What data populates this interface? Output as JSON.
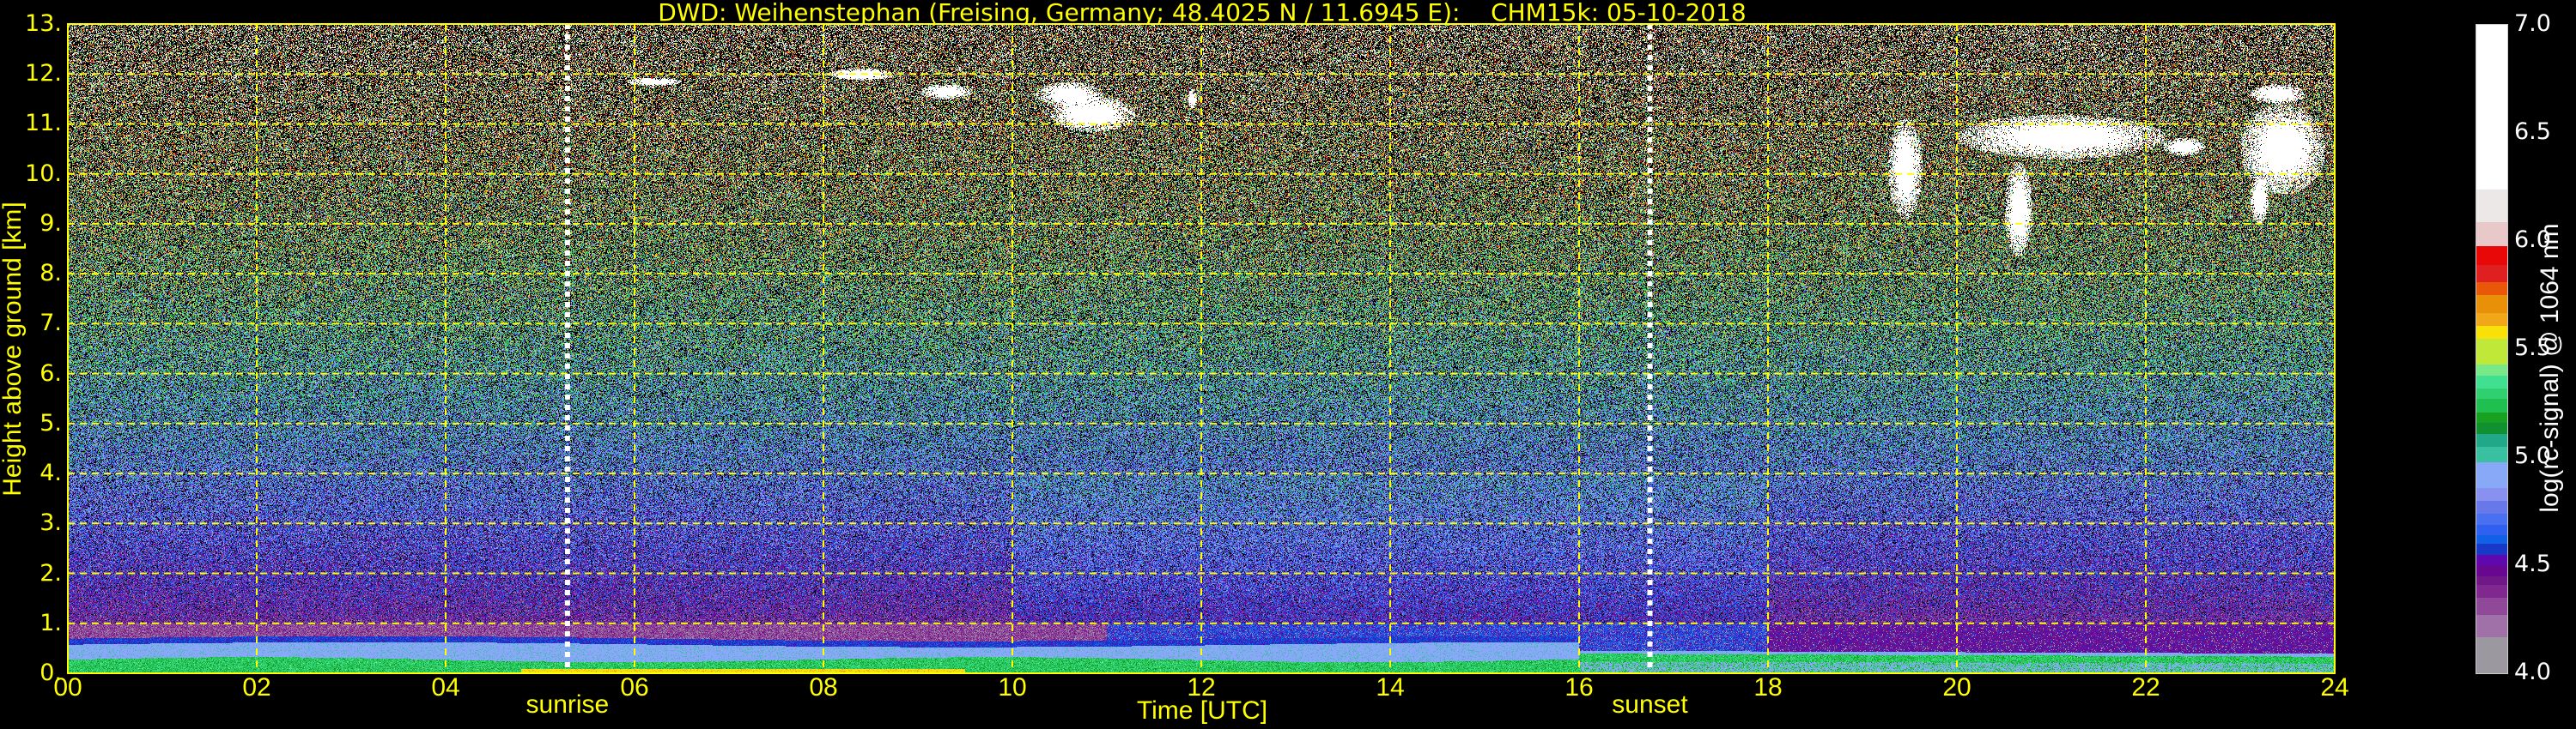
{
  "chart_data": {
    "type": "heatmap",
    "title": "DWD: Weihenstephan (Freising, Germany; 48.4025 N / 11.6945 E):    CHM15k: 05-10-2018",
    "xlabel": "Time [UTC]",
    "ylabel": "Height above ground [km]",
    "xlim": [
      0,
      24
    ],
    "ylim": [
      0,
      13
    ],
    "xticks": [
      "00",
      "02",
      "04",
      "06",
      "08",
      "10",
      "12",
      "14",
      "16",
      "18",
      "20",
      "22",
      "24"
    ],
    "xtick_values": [
      0,
      2,
      4,
      6,
      8,
      10,
      12,
      14,
      16,
      18,
      20,
      22,
      24
    ],
    "yticks": [
      "0.",
      "1.",
      "2.",
      "3.",
      "4.",
      "5.",
      "6.",
      "7.",
      "8.",
      "9.",
      "10.",
      "11.",
      "12.",
      "13."
    ],
    "ytick_values": [
      0,
      1,
      2,
      3,
      4,
      5,
      6,
      7,
      8,
      9,
      10,
      11,
      12,
      13
    ],
    "grid": true,
    "grid_color": "#ffff00",
    "sunrise": {
      "label": "sunrise",
      "time_h": 5.29
    },
    "sunset": {
      "label": "sunset",
      "time_h": 16.75
    },
    "colorbar": {
      "label": "log(rc-signal) @ 1064 nm",
      "range": [
        4.0,
        7.0
      ],
      "ticks": [
        "4.0",
        "4.5",
        "5.0",
        "5.5",
        "6.0",
        "6.5",
        "7.0"
      ],
      "tick_values": [
        4.0,
        4.5,
        5.0,
        5.5,
        6.0,
        6.5,
        7.0
      ],
      "levels": [
        {
          "from": 4.0,
          "to": 4.17,
          "color": "#9b98a0"
        },
        {
          "from": 4.17,
          "to": 4.27,
          "color": "#a070a8"
        },
        {
          "from": 4.27,
          "to": 4.35,
          "color": "#904898"
        },
        {
          "from": 4.35,
          "to": 4.41,
          "color": "#802890"
        },
        {
          "from": 4.41,
          "to": 4.45,
          "color": "#701888"
        },
        {
          "from": 4.45,
          "to": 4.5,
          "color": "#680890"
        },
        {
          "from": 4.5,
          "to": 4.55,
          "color": "#6008b0"
        },
        {
          "from": 4.55,
          "to": 4.6,
          "color": "#1838c8"
        },
        {
          "from": 4.6,
          "to": 4.64,
          "color": "#1060e8"
        },
        {
          "from": 4.64,
          "to": 4.69,
          "color": "#3060f0"
        },
        {
          "from": 4.69,
          "to": 4.74,
          "color": "#4870f0"
        },
        {
          "from": 4.74,
          "to": 4.8,
          "color": "#6878e8"
        },
        {
          "from": 4.8,
          "to": 4.86,
          "color": "#8890f0"
        },
        {
          "from": 4.86,
          "to": 4.98,
          "color": "#88a8f8"
        },
        {
          "from": 4.98,
          "to": 5.05,
          "color": "#38c0a0"
        },
        {
          "from": 5.05,
          "to": 5.11,
          "color": "#20a888"
        },
        {
          "from": 5.11,
          "to": 5.16,
          "color": "#109030"
        },
        {
          "from": 5.16,
          "to": 5.21,
          "color": "#18a020"
        },
        {
          "from": 5.21,
          "to": 5.27,
          "color": "#20c050"
        },
        {
          "from": 5.27,
          "to": 5.32,
          "color": "#30d070"
        },
        {
          "from": 5.32,
          "to": 5.38,
          "color": "#40e090"
        },
        {
          "from": 5.38,
          "to": 5.43,
          "color": "#78e888"
        },
        {
          "from": 5.43,
          "to": 5.55,
          "color": "#c0e838"
        },
        {
          "from": 5.55,
          "to": 5.61,
          "color": "#f8e008"
        },
        {
          "from": 5.61,
          "to": 5.67,
          "color": "#f0a818"
        },
        {
          "from": 5.67,
          "to": 5.75,
          "color": "#e89008"
        },
        {
          "from": 5.75,
          "to": 5.81,
          "color": "#e85808"
        },
        {
          "from": 5.81,
          "to": 5.89,
          "color": "#e02020"
        },
        {
          "from": 5.89,
          "to": 5.98,
          "color": "#e80808"
        },
        {
          "from": 5.98,
          "to": 6.09,
          "color": "#e8c8c8"
        },
        {
          "from": 6.09,
          "to": 6.24,
          "color": "#ece8e8"
        },
        {
          "from": 6.24,
          "to": 7.0,
          "color": "#ffffff"
        }
      ]
    },
    "cloud_features": [
      {
        "time_h": 6.2,
        "height_km": 11.85,
        "dt": 0.3,
        "dh": 0.08
      },
      {
        "time_h": 8.4,
        "height_km": 12.0,
        "dt": 0.35,
        "dh": 0.12
      },
      {
        "time_h": 9.3,
        "height_km": 11.65,
        "dt": 0.28,
        "dh": 0.15
      },
      {
        "time_h": 10.85,
        "height_km": 11.2,
        "dt": 0.45,
        "dh": 0.35
      },
      {
        "time_h": 10.6,
        "height_km": 11.6,
        "dt": 0.35,
        "dh": 0.25
      },
      {
        "time_h": 11.9,
        "height_km": 11.5,
        "dt": 0.05,
        "dh": 0.2
      },
      {
        "time_h": 19.45,
        "height_km": 10.1,
        "dt": 0.18,
        "dh": 1.0
      },
      {
        "time_h": 21.1,
        "height_km": 10.75,
        "dt": 1.1,
        "dh": 0.45
      },
      {
        "time_h": 20.65,
        "height_km": 9.3,
        "dt": 0.15,
        "dh": 0.95
      },
      {
        "time_h": 22.4,
        "height_km": 10.55,
        "dt": 0.22,
        "dh": 0.18
      },
      {
        "time_h": 23.45,
        "height_km": 10.5,
        "dt": 0.45,
        "dh": 0.9
      },
      {
        "time_h": 23.2,
        "height_km": 9.5,
        "dt": 0.1,
        "dh": 0.5
      },
      {
        "time_h": 23.4,
        "height_km": 11.6,
        "dt": 0.3,
        "dh": 0.2
      }
    ]
  }
}
